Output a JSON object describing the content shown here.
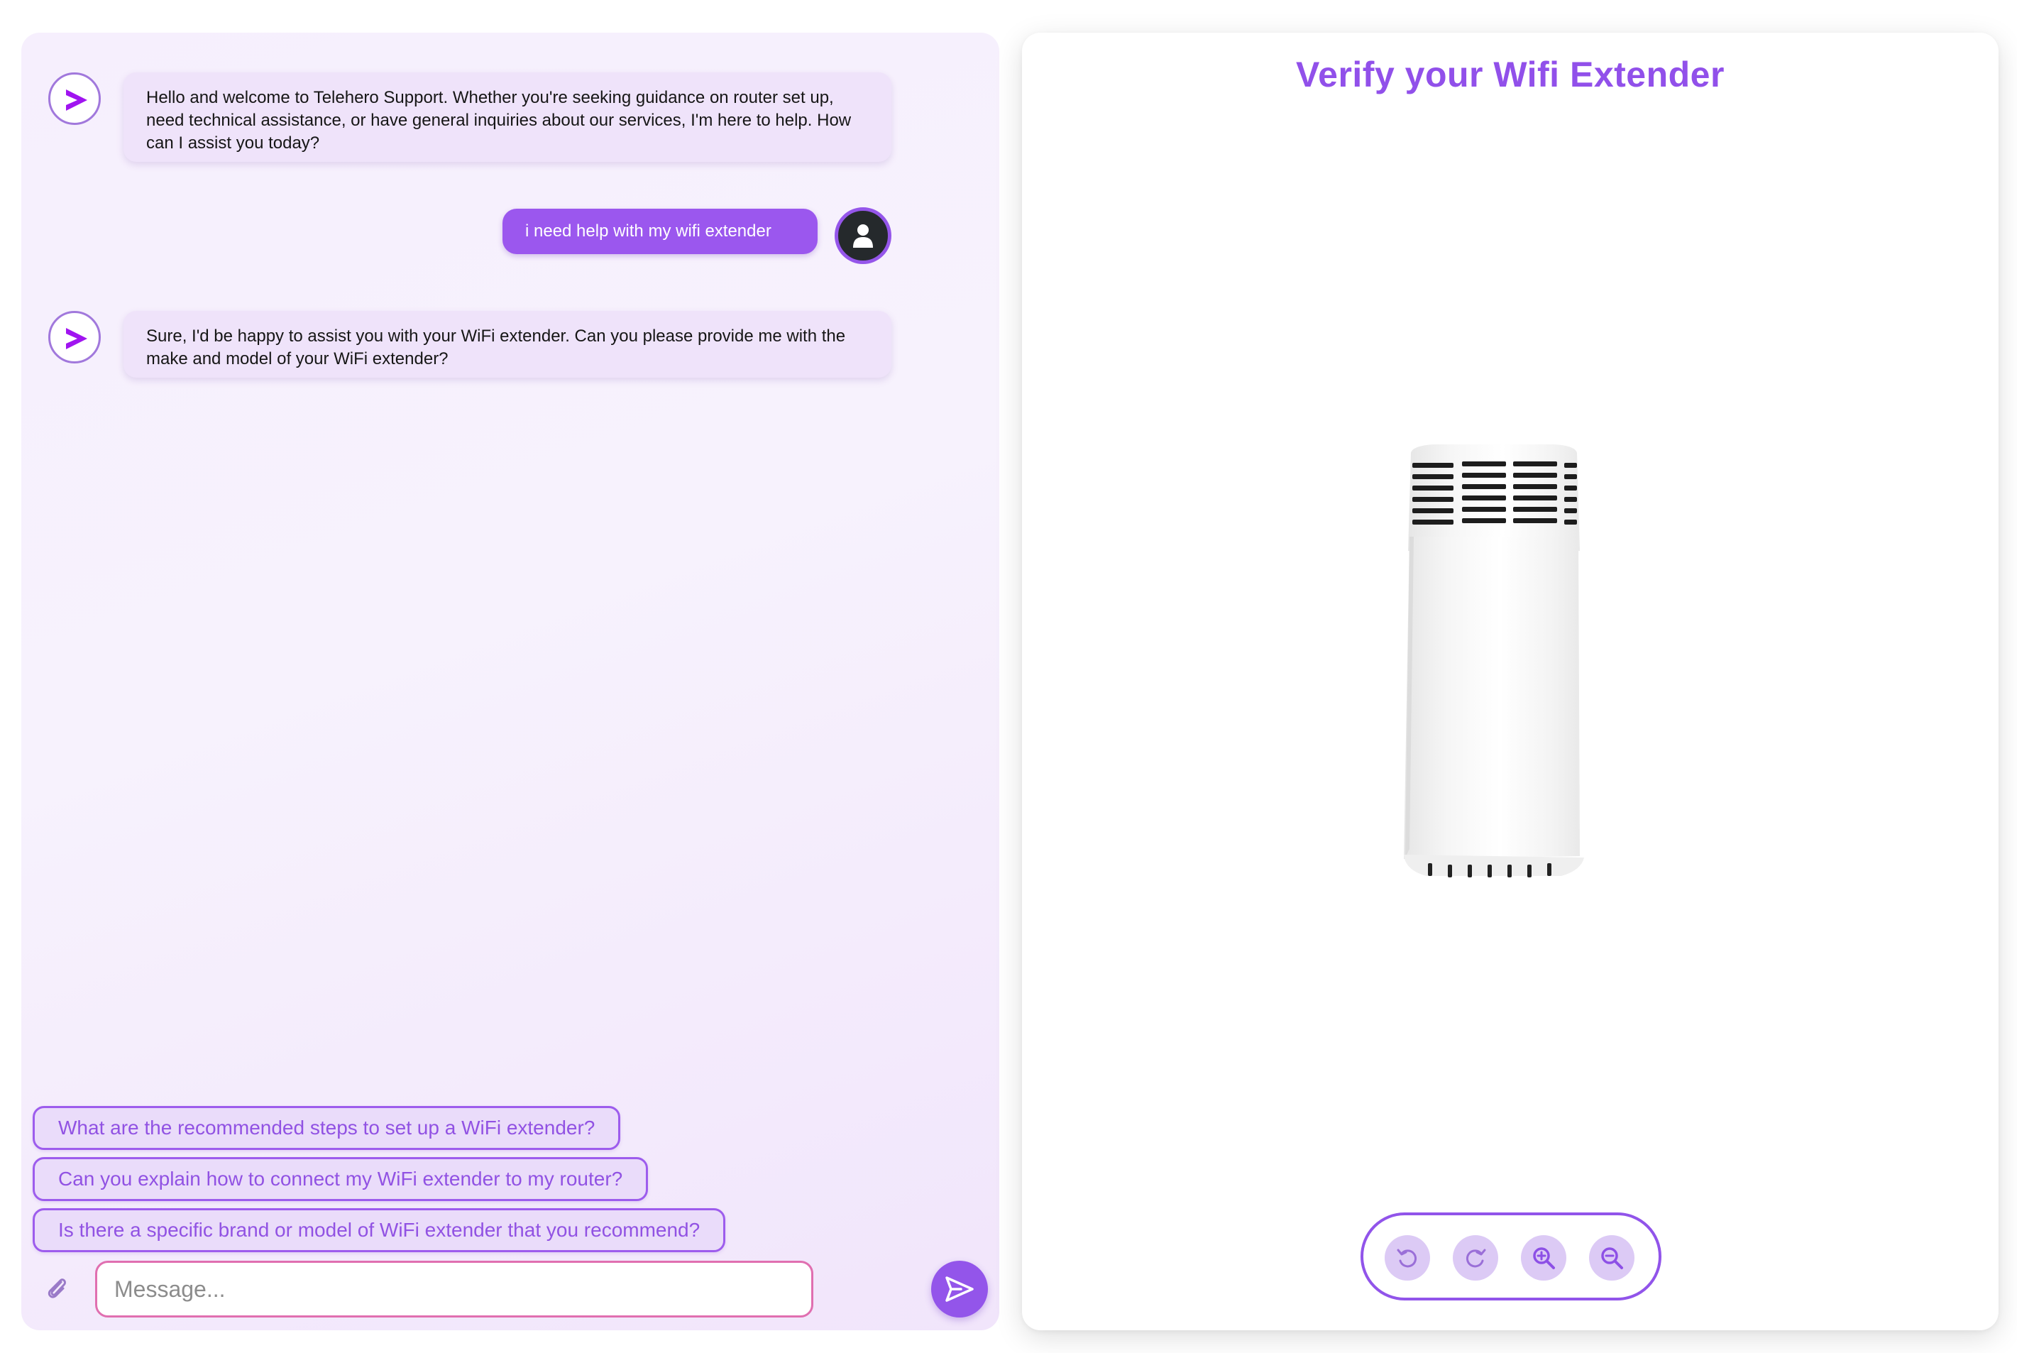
{
  "chat": {
    "messages": [
      {
        "sender": "bot",
        "text": "Hello and welcome to Telehero Support. Whether you're seeking guidance on router set up, need technical assistance, or have general inquiries about our services, I'm here to help. How can I assist you today?"
      },
      {
        "sender": "user",
        "text": "i need help with my wifi extender"
      },
      {
        "sender": "bot",
        "text": "Sure, I'd be happy to assist you with your WiFi extender. Can you please provide me with the make and model of your WiFi extender?"
      }
    ],
    "suggestions": [
      "What are the recommended steps to set up a WiFi extender?",
      "Can you explain how to connect my WiFi extender to my router?",
      "Is there a specific brand or model of WiFi extender that you recommend?"
    ],
    "input": {
      "placeholder": "Message...",
      "value": ""
    },
    "icons": {
      "attach": "paperclip-icon",
      "send": "send-icon",
      "bot": "chevron-right-logo-icon",
      "user": "user-icon"
    }
  },
  "viewer": {
    "title": "Verify your Wifi Extender",
    "controls": [
      {
        "name": "rotate-left",
        "icon": "rotate-left-icon"
      },
      {
        "name": "rotate-right",
        "icon": "rotate-right-icon"
      },
      {
        "name": "zoom-in",
        "icon": "zoom-in-icon"
      },
      {
        "name": "zoom-out",
        "icon": "zoom-out-icon"
      }
    ]
  },
  "colors": {
    "accent": "#9355ea",
    "bot_bubble": "#efe3fa",
    "user_bubble": "#9b57ee",
    "input_border": "#e06fb0"
  }
}
